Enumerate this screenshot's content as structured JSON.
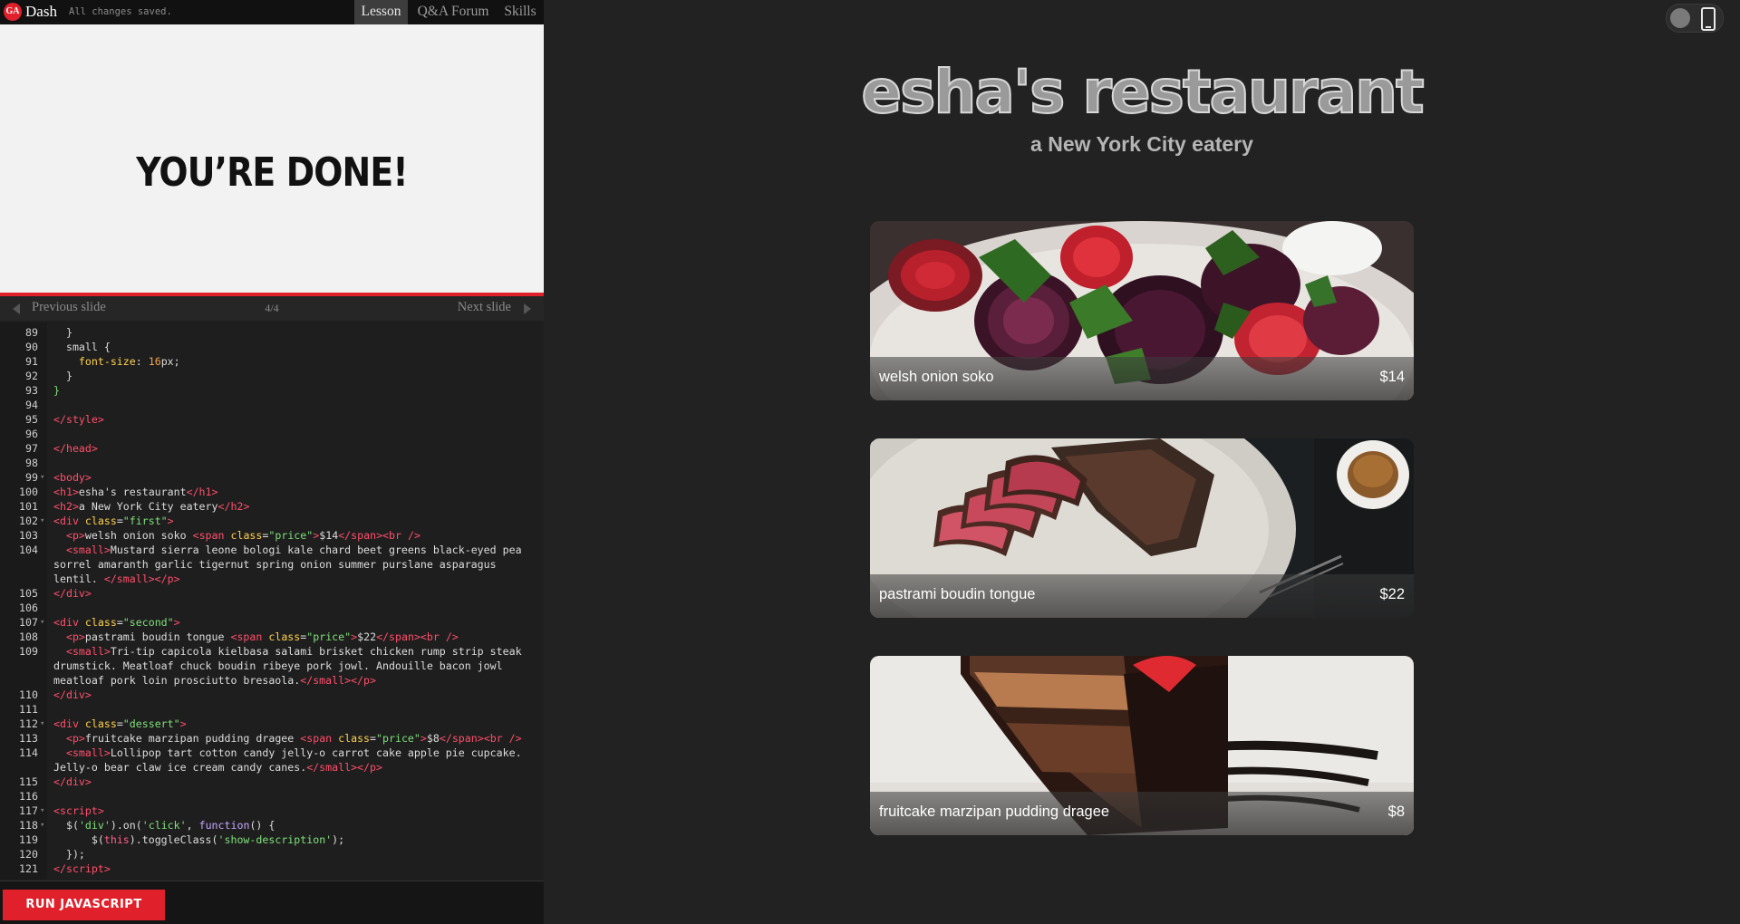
{
  "topbar": {
    "logo_text": "GA",
    "app_name": "Dash",
    "save_status": "All changes saved.",
    "tabs": [
      {
        "label": "Lesson",
        "active": true
      },
      {
        "label": "Q&A Forum",
        "active": false
      },
      {
        "label": "Skills",
        "active": false
      }
    ]
  },
  "slide": {
    "title": "YOU’RE DONE!",
    "prev_label": "Previous slide",
    "next_label": "Next slide",
    "counter": "4/4"
  },
  "editor": {
    "lines": [
      {
        "n": "89",
        "fold": false,
        "html": "  }"
      },
      {
        "n": "90",
        "fold": false,
        "html": "  small {"
      },
      {
        "n": "91",
        "fold": false,
        "html": "    <span class=\"t-attr\">font-size</span>: <span class=\"t-num\">16</span>px;"
      },
      {
        "n": "92",
        "fold": false,
        "html": "  }"
      },
      {
        "n": "93",
        "fold": false,
        "html": "<span class=\"t-str\">}</span>"
      },
      {
        "n": "94",
        "fold": false,
        "html": ""
      },
      {
        "n": "95",
        "fold": false,
        "html": "<span class=\"t-tag\">&lt;/style&gt;</span>"
      },
      {
        "n": "96",
        "fold": false,
        "html": ""
      },
      {
        "n": "97",
        "fold": false,
        "html": "<span class=\"t-tag\">&lt;/head&gt;</span>"
      },
      {
        "n": "98",
        "fold": false,
        "html": ""
      },
      {
        "n": "99",
        "fold": true,
        "html": "<span class=\"t-tag\">&lt;body&gt;</span>"
      },
      {
        "n": "100",
        "fold": false,
        "html": "<span class=\"t-tag\">&lt;h1&gt;</span>esha's restaurant<span class=\"t-tag\">&lt;/h1&gt;</span>"
      },
      {
        "n": "101",
        "fold": false,
        "html": "<span class=\"t-tag\">&lt;h2&gt;</span>a New York City eatery<span class=\"t-tag\">&lt;/h2&gt;</span>"
      },
      {
        "n": "102",
        "fold": true,
        "html": "<span class=\"t-tag\">&lt;div</span> <span class=\"t-attr\">class</span>=<span class=\"t-str\">\"first\"</span><span class=\"t-tag\">&gt;</span>"
      },
      {
        "n": "103",
        "fold": false,
        "html": "  <span class=\"t-tag\">&lt;p&gt;</span>welsh onion soko <span class=\"t-tag\">&lt;span</span> <span class=\"t-attr\">class</span>=<span class=\"t-str\">\"price\"</span><span class=\"t-tag\">&gt;</span>$14<span class=\"t-tag\">&lt;/span&gt;&lt;br /&gt;</span>"
      },
      {
        "n": "104",
        "fold": false,
        "h": 3,
        "html": "  <span class=\"t-tag\">&lt;small&gt;</span>Mustard sierra leone bologi kale chard beet greens black-eyed pea sorrel amaranth garlic tigernut spring onion summer purslane asparagus lentil. <span class=\"t-tag\">&lt;/small&gt;&lt;/p&gt;</span>"
      },
      {
        "n": "105",
        "fold": false,
        "html": "<span class=\"t-tag\">&lt;/div&gt;</span>"
      },
      {
        "n": "106",
        "fold": false,
        "html": ""
      },
      {
        "n": "107",
        "fold": true,
        "html": "<span class=\"t-tag\">&lt;div</span> <span class=\"t-attr\">class</span>=<span class=\"t-str\">\"second\"</span><span class=\"t-tag\">&gt;</span>"
      },
      {
        "n": "108",
        "fold": false,
        "html": "  <span class=\"t-tag\">&lt;p&gt;</span>pastrami boudin tongue <span class=\"t-tag\">&lt;span</span> <span class=\"t-attr\">class</span>=<span class=\"t-str\">\"price\"</span><span class=\"t-tag\">&gt;</span>$22<span class=\"t-tag\">&lt;/span&gt;&lt;br /&gt;</span>"
      },
      {
        "n": "109",
        "fold": false,
        "h": 3,
        "html": "  <span class=\"t-tag\">&lt;small&gt;</span>Tri-tip capicola kielbasa salami brisket chicken rump strip steak drumstick. Meatloaf chuck boudin ribeye pork jowl. Andouille bacon jowl meatloaf pork loin prosciutto bresaola.<span class=\"t-tag\">&lt;/small&gt;&lt;/p&gt;</span>"
      },
      {
        "n": "110",
        "fold": false,
        "html": "<span class=\"t-tag\">&lt;/div&gt;</span>"
      },
      {
        "n": "111",
        "fold": false,
        "html": ""
      },
      {
        "n": "112",
        "fold": true,
        "html": "<span class=\"t-tag\">&lt;div</span> <span class=\"t-attr\">class</span>=<span class=\"t-str\">\"dessert\"</span><span class=\"t-tag\">&gt;</span>"
      },
      {
        "n": "113",
        "fold": false,
        "html": "  <span class=\"t-tag\">&lt;p&gt;</span>fruitcake marzipan pudding dragee <span class=\"t-tag\">&lt;span</span> <span class=\"t-attr\">class</span>=<span class=\"t-str\">\"price\"</span><span class=\"t-tag\">&gt;</span>$8<span class=\"t-tag\">&lt;/span&gt;&lt;br /&gt;</span>"
      },
      {
        "n": "114",
        "fold": false,
        "h": 2,
        "html": "  <span class=\"t-tag\">&lt;small&gt;</span>Lollipop tart cotton candy jelly-o carrot cake apple pie cupcake. Jelly-o bear claw ice cream candy canes.<span class=\"t-tag\">&lt;/small&gt;&lt;/p&gt;</span>"
      },
      {
        "n": "115",
        "fold": false,
        "html": "<span class=\"t-tag\">&lt;/div&gt;</span>"
      },
      {
        "n": "116",
        "fold": false,
        "html": ""
      },
      {
        "n": "117",
        "fold": true,
        "html": "<span class=\"t-tag\">&lt;script&gt;</span>"
      },
      {
        "n": "118",
        "fold": true,
        "html": "  $(<span class=\"t-str\">'div'</span>).on(<span class=\"t-str\">'click'</span>, <span class=\"t-fn\">function</span>() {"
      },
      {
        "n": "119",
        "fold": false,
        "html": "      $(<span class=\"t-kw\">this</span>).toggleClass(<span class=\"t-str\">'show-description'</span>);"
      },
      {
        "n": "120",
        "fold": false,
        "html": "  });"
      },
      {
        "n": "121",
        "fold": false,
        "html": "<span class=\"t-tag\">&lt;/script&gt;</span>"
      }
    ]
  },
  "run_button_label": "RUN JAVASCRIPT",
  "preview": {
    "title": "esha's restaurant",
    "subtitle": "a New York City eatery",
    "items": [
      {
        "name": "welsh onion soko",
        "price": "$14",
        "image": "beet-salad-photo"
      },
      {
        "name": "pastrami boudin tongue",
        "price": "$22",
        "image": "sliced-steak-photo"
      },
      {
        "name": "fruitcake marzipan pudding dragee",
        "price": "$8",
        "image": "chocolate-cake-photo"
      }
    ]
  },
  "colors": {
    "accent": "#e0202a",
    "preview_bg": "#222222",
    "slide_bg": "#f2f2f2"
  }
}
